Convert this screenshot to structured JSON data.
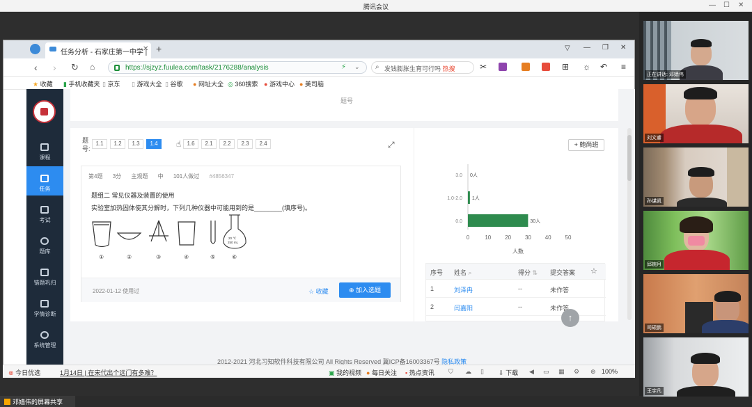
{
  "meeting": {
    "title": "腾讯会议",
    "share_label": "邓嫱伟的屏幕共享"
  },
  "browser": {
    "tab_title": "任务分析 - 石家庄第一中学 |",
    "url": "https://sjzyz.fuulea.com/task/2176288/analysis",
    "search_text": "发钱膨胀生育可行吗",
    "search_badge": "热搜",
    "bookmarks": [
      "收藏",
      "手机收藏夹",
      "京东",
      "游戏大全",
      "谷歌",
      "网址大全",
      "360搜索",
      "游戏中心",
      "美司脑"
    ]
  },
  "site_nav": [
    "课程",
    "任务",
    "考试",
    "题库",
    "错题巩归",
    "学情诊断",
    "系统管理"
  ],
  "page": {
    "top_card_label": "题号",
    "question_nav_label": "题号:",
    "question_tabs": [
      "1.1",
      "1.2",
      "1.3",
      "1.4",
      "1.5",
      "1.6",
      "2.1",
      "2.2",
      "2.3",
      "2.4"
    ],
    "active_tab": "1.4",
    "question": {
      "meta": [
        "第4题",
        "3分",
        "主观题",
        "中",
        "101人做过",
        "#4856347"
      ],
      "topic": "题组二   常见仪器及装置的使用",
      "text": "实验室加热固体使其分解时，下列几种仪器中可能用到的是________(填序号)。",
      "items": [
        "①",
        "②",
        "③",
        "④",
        "⑤",
        "⑥"
      ],
      "flask_label_line1": "20 ℃",
      "flask_label_line2": "250 mL",
      "date": "2022-01-12 使用过",
      "fav_label": "收藏",
      "add_label": "加入选题"
    },
    "class_button": "+ 鲍尚班",
    "chart_data": {
      "type": "bar",
      "orientation": "horizontal",
      "categories": [
        "3.0",
        "1.0-2.0",
        "0.0"
      ],
      "values": [
        0,
        1,
        30
      ],
      "data_labels": [
        "0人",
        "1人",
        "30人"
      ],
      "xlabel": "人数",
      "xlim": [
        0,
        50
      ],
      "xticks": [
        0,
        10,
        20,
        30,
        40,
        50
      ],
      "color": "#2e8b4e"
    },
    "table": {
      "headers": [
        "序号",
        "姓名",
        "得分",
        "提交答案"
      ],
      "rows": [
        {
          "index": "1",
          "name": "刘泽冉",
          "score": "--",
          "answer": "未作答"
        },
        {
          "index": "2",
          "name": "闫嘉阳",
          "score": "--",
          "answer": "未作答"
        }
      ]
    },
    "copyright": "2012-2021 河北习知软件科技有限公司 All Rights Reserved 冀ICP备16003367号",
    "privacy": "隐私政策"
  },
  "statusbar": {
    "left": "今日优选",
    "news": "1月14日 | 在宋代出个远门有多难？",
    "items": [
      "我的视频",
      "每日关注",
      "热点资讯",
      "下载"
    ],
    "zoom": "100%"
  },
  "videos": [
    {
      "name": "正在讲话: 邓嫱伟"
    },
    {
      "name": "刘文睿"
    },
    {
      "name": "孙谋凯"
    },
    {
      "name": "邱婉月"
    },
    {
      "name": "司硕鹏"
    },
    {
      "name": "王宇凡"
    }
  ],
  "colors": {
    "accent": "#2d8cf0",
    "nav_bg": "#1e2b3a",
    "bar": "#2e8b4e"
  }
}
